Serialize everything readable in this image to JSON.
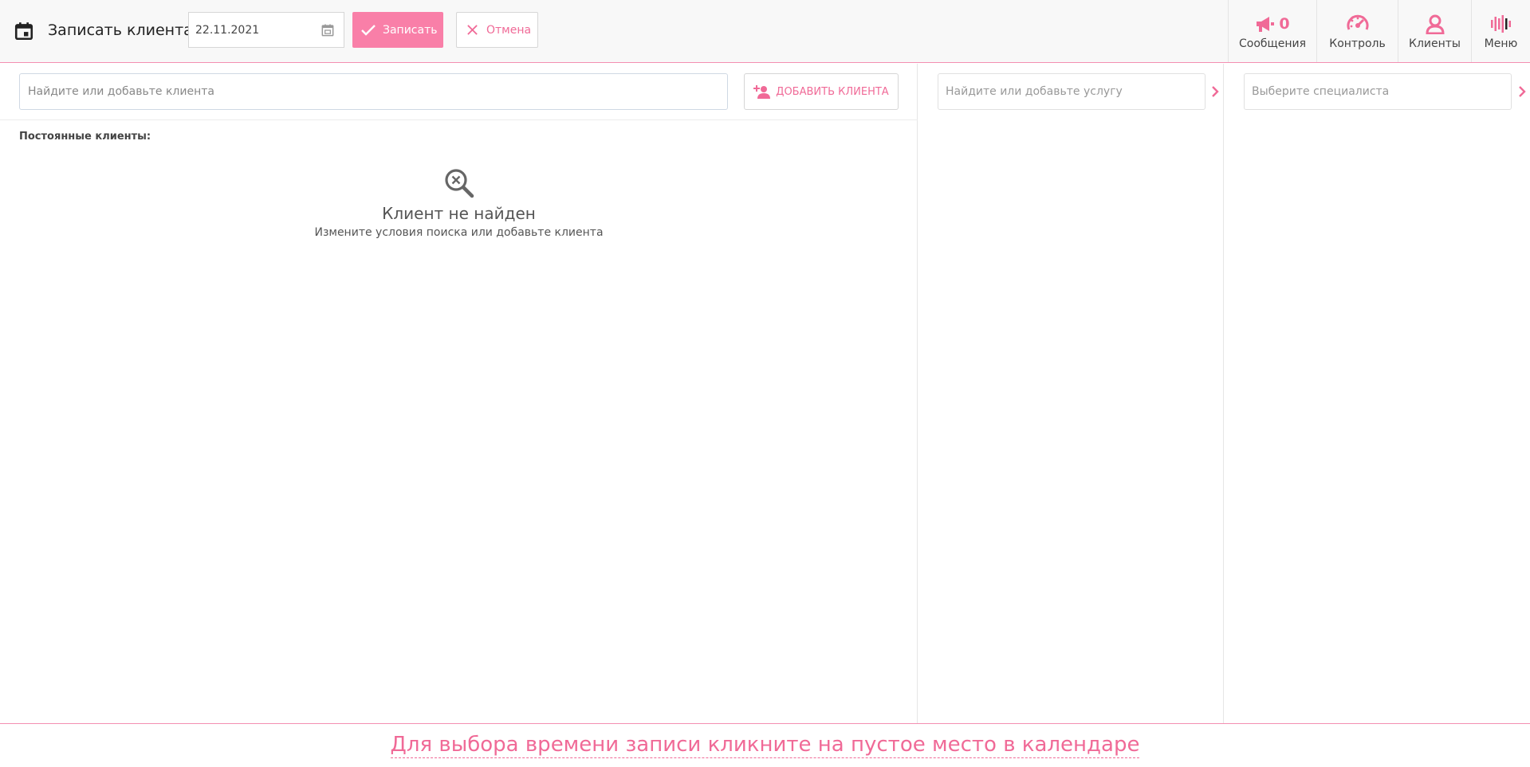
{
  "header": {
    "title": "Записать клиента",
    "date_value": "22.11.2021",
    "save_label": "Записать",
    "cancel_label": "Отмена"
  },
  "nav": {
    "messages": {
      "label": "Сообщения",
      "count": "0"
    },
    "control": {
      "label": "Контроль"
    },
    "clients": {
      "label": "Клиенты"
    },
    "menu": {
      "label": "Меню"
    }
  },
  "client_panel": {
    "search_placeholder": "Найдите или добавьте клиента",
    "add_button_label": "Добавить клиента",
    "regulars_label": "Постоянные клиенты:",
    "empty_title": "Клиент не найден",
    "empty_subtitle": "Измените условия поиска или добавьте клиента"
  },
  "service_panel": {
    "search_placeholder": "Найдите или добавьте услугу"
  },
  "specialist_panel": {
    "search_placeholder": "Выберите специалиста"
  },
  "footer": {
    "hint": "Для выбора времени записи кликните на пустое место в календаре"
  },
  "colors": {
    "accent": "#f06a97",
    "accent_fill": "#f97fa8",
    "border": "#d6d6d6"
  },
  "icons": {
    "title": "calendar-icon",
    "date": "calendar-small-icon",
    "save": "check-icon",
    "cancel": "close-icon",
    "messages": "megaphone-icon",
    "control": "speedometer-icon",
    "clients": "person-icon",
    "menu": "bars-icon",
    "add_client": "person-add-icon",
    "empty": "search-x-icon",
    "next": "chevron-right-icon"
  }
}
